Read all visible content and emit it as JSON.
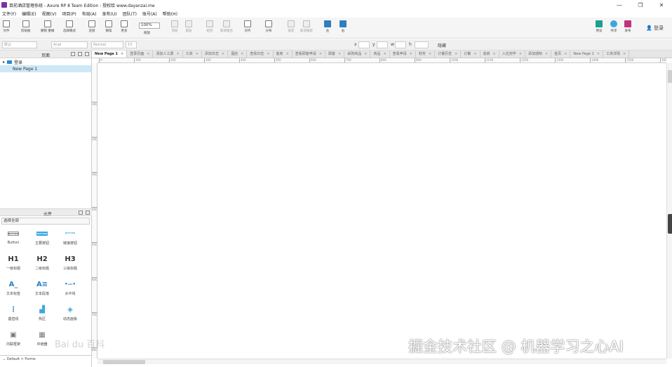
{
  "window": {
    "title": "目前酒店管理系统 - Axure RP 8 Team Edition : 授权给 www.dayanzai.me",
    "controls": {
      "minimize": "—",
      "maximize": "❐",
      "close": "✕"
    }
  },
  "menu": [
    "文件(F)",
    "编辑(E)",
    "视图(V)",
    "项目(P)",
    "布局(A)",
    "发布(U)",
    "团队(T)",
    "账号(A)",
    "帮助(H)"
  ],
  "toolbar": {
    "buttons": [
      {
        "label": "文件",
        "icon": "file-icon"
      },
      {
        "label": "剪贴板",
        "icon": "clipboard-icon"
      },
      {
        "label": "撤销 重做",
        "icon": "undo-icon"
      },
      {
        "label": "选择模式",
        "icon": "select-icon"
      },
      {
        "label": "连接",
        "icon": "connect-icon"
      },
      {
        "label": "钢笔",
        "icon": "pen-icon"
      },
      {
        "label": "更多",
        "icon": "more-icon"
      },
      {
        "label": "缩放",
        "icon": "zoom-icon"
      },
      {
        "label": "顶层",
        "icon": "top-icon"
      },
      {
        "label": "底层",
        "icon": "bottom-icon"
      },
      {
        "label": "组合",
        "icon": "group-icon"
      },
      {
        "label": "取消组合",
        "icon": "ungroup-icon"
      },
      {
        "label": "对齐",
        "icon": "align-icon"
      },
      {
        "label": "分布",
        "icon": "distribute-icon"
      },
      {
        "label": "锁定",
        "icon": "lock-icon"
      },
      {
        "label": "取消锁定",
        "icon": "unlock-icon"
      },
      {
        "label": "左",
        "icon": "left-icon"
      },
      {
        "label": "右",
        "icon": "right-icon"
      },
      {
        "label": "预览",
        "icon": "preview-icon"
      },
      {
        "label": "共享",
        "icon": "share-icon"
      },
      {
        "label": "发布",
        "icon": "publish-icon"
      }
    ],
    "zoom": "100%",
    "login": "登录"
  },
  "stylebar": {
    "style_value": "默认",
    "font_value": "Arial",
    "weight_value": "Normal",
    "size_value": "13",
    "x_label": "x",
    "y_label": "y",
    "w_label": "w",
    "h_label": "h",
    "hidden_label": "隐藏"
  },
  "pages_panel": {
    "title": "页面",
    "items": [
      {
        "label": "登录",
        "type": "folder"
      },
      {
        "label": "New Page 1",
        "type": "page",
        "selected": true
      }
    ]
  },
  "widgets_panel": {
    "title": "元件",
    "library": "选择全部",
    "items": [
      {
        "label": "Button",
        "icon": "button-icon",
        "glyph": "BUTTON"
      },
      {
        "label": "主要按钮",
        "icon": "primary-button-icon",
        "glyph": "BUTTON"
      },
      {
        "label": "链接按钮",
        "icon": "link-button-icon",
        "glyph": "BUTTON"
      },
      {
        "label": "一级标题",
        "icon": "h1-icon",
        "glyph": "H1"
      },
      {
        "label": "二级标题",
        "icon": "h2-icon",
        "glyph": "H2"
      },
      {
        "label": "三级标题",
        "icon": "h3-icon",
        "glyph": "H3"
      },
      {
        "label": "文本标签",
        "icon": "text-label-icon",
        "glyph": "A_"
      },
      {
        "label": "文本段落",
        "icon": "paragraph-icon",
        "glyph": "A≡"
      },
      {
        "label": "水平线",
        "icon": "horizontal-line-icon",
        "glyph": "•—•"
      },
      {
        "label": "垂直线",
        "icon": "vertical-line-icon",
        "glyph": "⋮"
      },
      {
        "label": "热区",
        "icon": "hotspot-icon",
        "glyph": "▟"
      },
      {
        "label": "动态面板",
        "icon": "dynamic-panel-icon",
        "glyph": "◈"
      },
      {
        "label": "内联框架",
        "icon": "inline-frame-icon",
        "glyph": "▣"
      },
      {
        "label": "中继器",
        "icon": "repeater-icon",
        "glyph": "▦"
      }
    ],
    "footer": "Default > Forms"
  },
  "tabs": [
    {
      "label": "New Page 1",
      "active": true
    },
    {
      "label": "登录页面"
    },
    {
      "label": "添加人工费"
    },
    {
      "label": "工资"
    },
    {
      "label": "添加日志"
    },
    {
      "label": "酒店"
    },
    {
      "label": "查看日志"
    },
    {
      "label": "客房"
    },
    {
      "label": "查看顾客申请"
    },
    {
      "label": "顾客"
    },
    {
      "label": "采购商品"
    },
    {
      "label": "商品"
    },
    {
      "label": "查看申请"
    },
    {
      "label": "财务"
    },
    {
      "label": "订餐历史"
    },
    {
      "label": "订餐"
    },
    {
      "label": "退房"
    },
    {
      "label": "入住完毕"
    },
    {
      "label": "添加通知"
    },
    {
      "label": "首页"
    },
    {
      "label": "New Page 1"
    },
    {
      "label": "工资详情"
    }
  ],
  "ruler": {
    "h_ticks": [
      "0",
      "100",
      "200",
      "300",
      "400",
      "500",
      "600",
      "700",
      "800",
      "900",
      "1000",
      "1100",
      "1200",
      "1300",
      "1400",
      "1500",
      "1600"
    ],
    "v_ticks": [
      "100",
      "200",
      "300",
      "400",
      "500",
      "600",
      "700",
      "800"
    ]
  },
  "watermark": {
    "main": "掘金技术社区 @ 机器学习之心AI",
    "small": "Bai du 百科"
  },
  "colors": {
    "accent": "#2d7fc1",
    "selected_row": "#cde8f6",
    "folder": "#2a8ad4"
  }
}
